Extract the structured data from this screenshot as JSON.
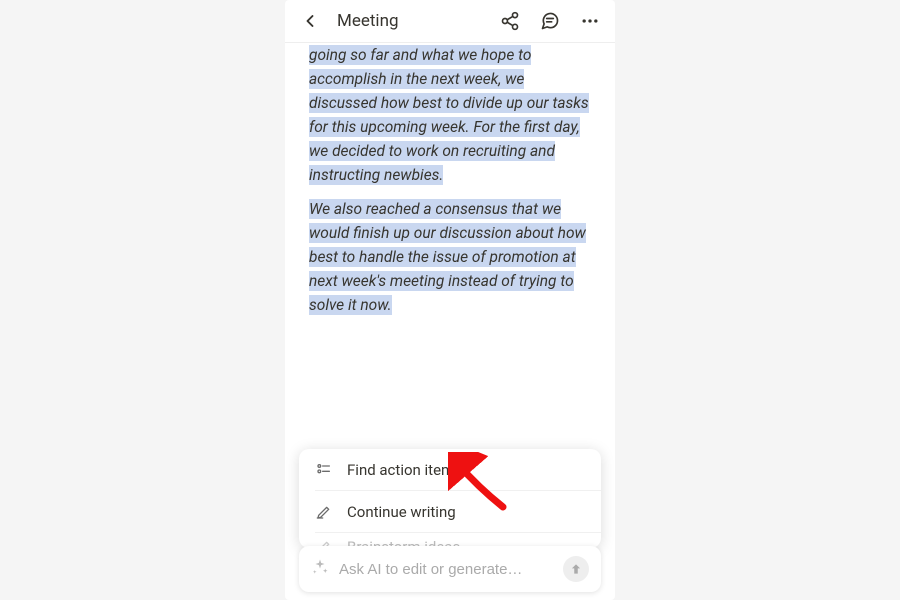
{
  "header": {
    "title": "Meeting"
  },
  "content": {
    "para1": "going so far and what we hope to accomplish in the next week, we discussed how best to divide up our tasks for this upcoming week. For the first day, we decided to work on recruiting and instructing newbies.",
    "para2": "We also reached a consensus that we would finish up our discussion about how best to handle the issue of promotion at next week's meeting instead of trying to solve it now."
  },
  "menu": {
    "item1": "Find action items",
    "item2": "Continue writing",
    "item3": "Brainstorm ideas"
  },
  "ai_bar": {
    "placeholder": "Ask AI to edit or generate…"
  }
}
